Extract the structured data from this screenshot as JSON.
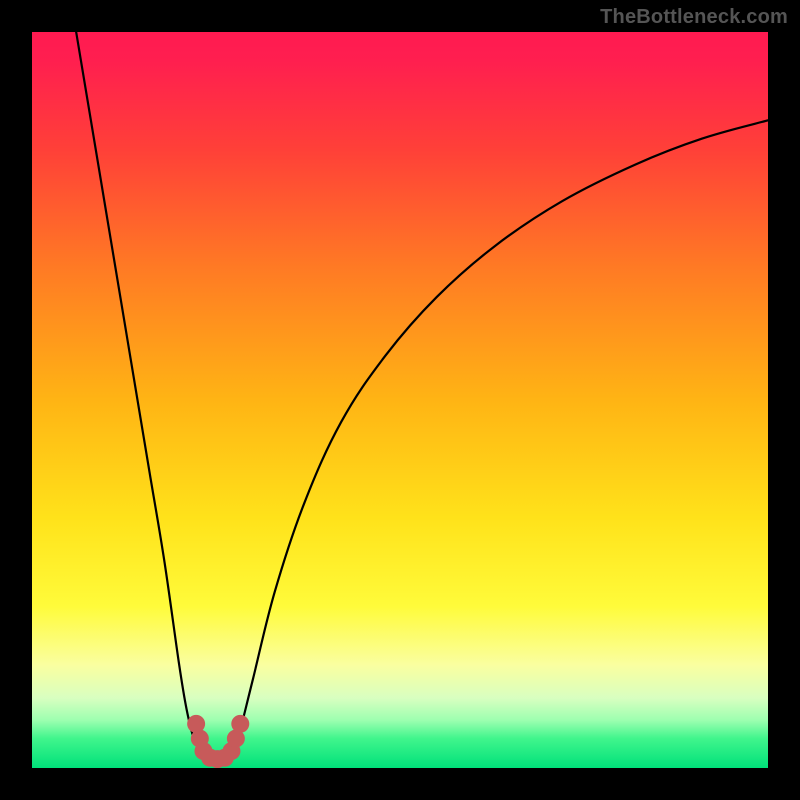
{
  "attribution": "TheBottleneck.com",
  "chart_data": {
    "type": "line",
    "title": "",
    "xlabel": "",
    "ylabel": "",
    "xlim": [
      0,
      100
    ],
    "ylim": [
      0,
      100
    ],
    "series": [
      {
        "name": "curve-left",
        "x": [
          6,
          8,
          10,
          12,
          14,
          16,
          18,
          20,
          21,
          22,
          23.3
        ],
        "y": [
          100,
          88,
          76,
          64,
          52,
          40,
          28,
          14,
          8,
          4,
          1.5
        ]
      },
      {
        "name": "curve-right",
        "x": [
          27.2,
          28,
          30,
          33,
          37,
          42,
          48,
          55,
          63,
          72,
          82,
          91,
          100
        ],
        "y": [
          1.5,
          4,
          12,
          24,
          36,
          47,
          56,
          64,
          71,
          77,
          82,
          85.5,
          88
        ]
      }
    ],
    "markers": {
      "points": [
        {
          "x": 22.3,
          "y": 6.0
        },
        {
          "x": 22.8,
          "y": 4.0
        },
        {
          "x": 23.3,
          "y": 2.3
        },
        {
          "x": 24.2,
          "y": 1.4
        },
        {
          "x": 25.2,
          "y": 1.2
        },
        {
          "x": 26.2,
          "y": 1.4
        },
        {
          "x": 27.1,
          "y": 2.3
        },
        {
          "x": 27.7,
          "y": 4.0
        },
        {
          "x": 28.3,
          "y": 6.0
        }
      ],
      "style": "filled-circle",
      "color": "#c75a5a",
      "radius_px": 9
    },
    "background": {
      "gradient_stops": [
        {
          "pos": 0.0,
          "color": "#ff1a51"
        },
        {
          "pos": 0.04,
          "color": "#ff1f4f"
        },
        {
          "pos": 0.16,
          "color": "#ff4038"
        },
        {
          "pos": 0.32,
          "color": "#ff7a24"
        },
        {
          "pos": 0.5,
          "color": "#ffb414"
        },
        {
          "pos": 0.66,
          "color": "#ffe21a"
        },
        {
          "pos": 0.78,
          "color": "#fffb3a"
        },
        {
          "pos": 0.86,
          "color": "#faffa0"
        },
        {
          "pos": 0.905,
          "color": "#d8ffc0"
        },
        {
          "pos": 0.935,
          "color": "#9dffb0"
        },
        {
          "pos": 0.96,
          "color": "#40f58c"
        },
        {
          "pos": 1.0,
          "color": "#00e17a"
        }
      ]
    },
    "colors": {
      "curve": "#000000",
      "frame_bg": "#000000"
    }
  }
}
